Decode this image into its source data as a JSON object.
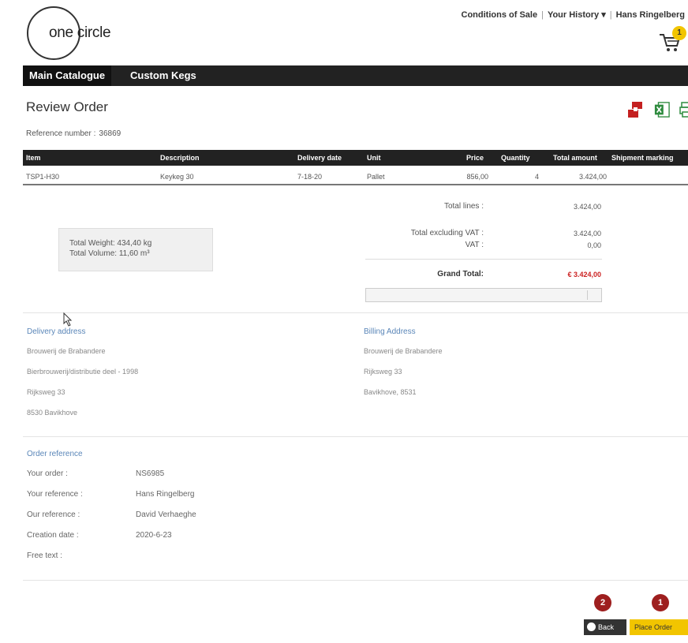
{
  "brand": {
    "logo_text": "one circle"
  },
  "toplinks": {
    "conditions": "Conditions of Sale",
    "history": "Your History",
    "history_caret": "▾",
    "user": "Hans Ringelberg"
  },
  "cart": {
    "count": "1"
  },
  "nav": {
    "main": "Main Catalogue",
    "kegs": "Custom Kegs"
  },
  "page": {
    "title": "Review Order",
    "ref_label": "Reference number :",
    "ref_value": "36869"
  },
  "table": {
    "headers": [
      "Item",
      "Description",
      "Delivery date",
      "Unit",
      "Price",
      "Quantity",
      "Total amount",
      "Shipment marking"
    ],
    "rows": [
      {
        "item": "TSP1-H30",
        "description": "Keykeg 30",
        "delivery": "7-18-20",
        "unit": "Pallet",
        "price": "856,00",
        "quantity": "4",
        "total": "3.424,00",
        "marking": ""
      }
    ]
  },
  "totals": {
    "total_lines_label": "Total lines :",
    "total_lines": "3.424,00",
    "excl_vat_label": "Total excluding VAT :",
    "excl_vat": "3.424,00",
    "vat_label": "VAT :",
    "vat": "0,00",
    "grand_label": "Grand Total:",
    "grand": "€ 3.424,00"
  },
  "weight": {
    "line1": "Total Weight: 434,40 kg",
    "line2": "Total Volume: 11,60 m³"
  },
  "delivery": {
    "title": "Delivery address",
    "lines": [
      "Brouwerij de Brabandere",
      "Bierbrouwerij/distributie deel - 1998",
      "Rijksweg 33",
      "8530 Bavikhove"
    ]
  },
  "billing": {
    "title": "Billing Address",
    "lines": [
      "Brouwerij de Brabandere",
      "Rijksweg 33",
      "Bavikhove, 8531"
    ]
  },
  "order_ref": {
    "title": "Order reference",
    "rows": [
      {
        "label": "Your order :",
        "value": "NS6985"
      },
      {
        "label": "Your reference :",
        "value": "Hans Ringelberg"
      },
      {
        "label": "Our reference :",
        "value": "David Verhaeghe"
      },
      {
        "label": "Creation date :",
        "value": "2020-6-23"
      },
      {
        "label": "Free text :",
        "value": ""
      }
    ]
  },
  "actions": {
    "back": "Back",
    "place": "Place Order",
    "step_back": "2",
    "step_place": "1"
  },
  "colors": {
    "accent": "#f2c500",
    "badge": "#9e1f1f",
    "link": "#5a86b8",
    "navbar": "#222222"
  }
}
